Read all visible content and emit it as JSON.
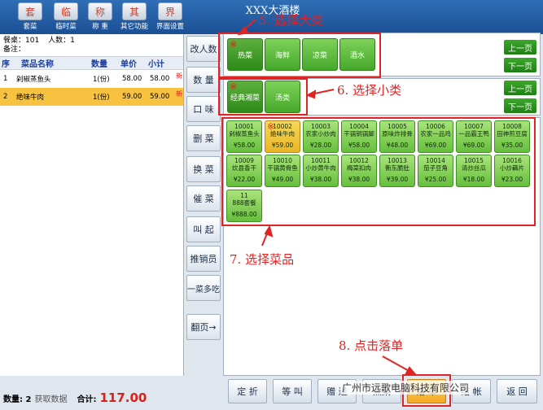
{
  "app_title": "XXX大酒楼",
  "toolbar": {
    "items": [
      {
        "label": "套菜",
        "icon": "套"
      },
      {
        "label": "临时菜",
        "icon": "临"
      },
      {
        "label": "称 重",
        "icon": "称"
      },
      {
        "label": "其它功能",
        "icon": "其"
      },
      {
        "label": "界面设置",
        "icon": "界"
      }
    ]
  },
  "order_info": {
    "table": "餐桌：101",
    "people": "人数：1",
    "remark": "备注："
  },
  "order_table": {
    "headers": [
      "序",
      "菜品名称",
      "数量",
      "单价",
      "小计"
    ],
    "rows": [
      {
        "no": "1",
        "name": "剁椒蒸鱼头",
        "qty": "1(份)",
        "price": "58.00",
        "subtotal": "58.00",
        "flag": "新"
      },
      {
        "no": "2",
        "name": "绝味牛肉",
        "qty": "1(份)",
        "price": "59.00",
        "subtotal": "59.00",
        "flag": "新"
      }
    ]
  },
  "footer": {
    "total_label": "合计:",
    "total_value": "117.00",
    "amount_label": "数量: 2",
    "status": "获取数据"
  },
  "functions": [
    "改人数",
    "数 量",
    "口 味",
    "删 菜",
    "换 菜",
    "催 菜",
    "叫 起",
    "推销员",
    "一菜多吃",
    "翻页→"
  ],
  "big_categories": [
    "热菜",
    "海鲜",
    "凉菜",
    "酒水"
  ],
  "small_categories": [
    "经典湘菜",
    "汤类"
  ],
  "paging": {
    "prev": "上一页",
    "next": "下一页"
  },
  "dishes": [
    {
      "code": "10001",
      "name": "剁椒蒸鱼头",
      "price": "¥58.00"
    },
    {
      "code": "10002",
      "name": "绝味牛肉",
      "price": "¥59.00"
    },
    {
      "code": "10003",
      "name": "农家小炒肉",
      "price": "¥28.00"
    },
    {
      "code": "10004",
      "name": "干锅铜锅脚",
      "price": "¥58.00"
    },
    {
      "code": "10005",
      "name": "原味炸排骨",
      "price": "¥48.00"
    },
    {
      "code": "10006",
      "name": "农家一品鸡",
      "price": "¥69.00"
    },
    {
      "code": "10007",
      "name": "一品霸王鸭",
      "price": "¥69.00"
    },
    {
      "code": "10008",
      "name": "田神煎豆腐",
      "price": "¥35.00"
    },
    {
      "code": "10009",
      "name": "炊县香干",
      "price": "¥22.00"
    },
    {
      "code": "10010",
      "name": "干锅黄骨鱼",
      "price": "¥49.00"
    },
    {
      "code": "10011",
      "name": "小炒黄牛肉",
      "price": "¥38.00"
    },
    {
      "code": "10012",
      "name": "梅菜扣肉",
      "price": "¥38.00"
    },
    {
      "code": "10013",
      "name": "衡东脆肚",
      "price": "¥39.00"
    },
    {
      "code": "10014",
      "name": "茄子豆角",
      "price": "¥25.00"
    },
    {
      "code": "10015",
      "name": "清炒丝瓜",
      "price": "¥18.00"
    },
    {
      "code": "10016",
      "name": "小炒藕片",
      "price": "¥23.00"
    },
    {
      "code": "11",
      "name": "888套餐",
      "price": "¥888.00"
    }
  ],
  "actions": [
    "定 折",
    "等 叫",
    "赠 送",
    "点菜",
    "落 单",
    "结 帐",
    "返 回"
  ],
  "annotations": {
    "step5": "5. 选择大类",
    "step6": "6. 选择小类",
    "step7": "7. 选择菜品",
    "step8": "8. 点击落单"
  },
  "watermark": "广州市远歌电脑科技有限公司",
  "accent_colors": {
    "annotation": "#e02424",
    "dish_green": "#66bf3d",
    "selected_yellow": "#f7c23f",
    "total_red": "#d8211b"
  }
}
